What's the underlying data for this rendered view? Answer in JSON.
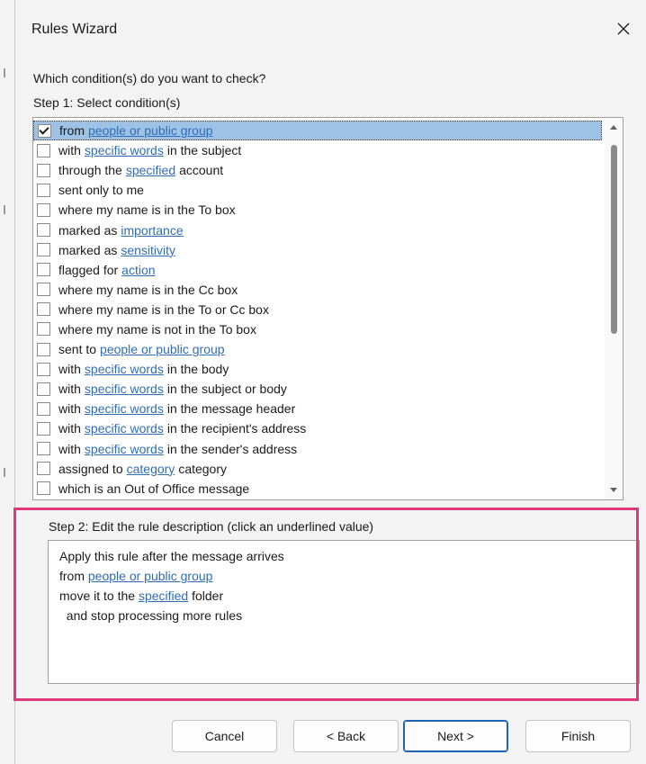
{
  "dialog": {
    "title": "Rules Wizard",
    "question": "Which condition(s) do you want to check?",
    "step1_label": "Step 1: Select condition(s)",
    "conditions": [
      {
        "pre": "from",
        "link": "people or public group",
        "post": "",
        "checked": true,
        "selected": true
      },
      {
        "pre": "with",
        "link": "specific words",
        "post": "in the subject",
        "checked": false
      },
      {
        "pre": "through the",
        "link": "specified",
        "post": "account",
        "checked": false
      },
      {
        "pre": "sent only to me",
        "link": "",
        "post": "",
        "checked": false
      },
      {
        "pre": "where my name is in the To box",
        "link": "",
        "post": "",
        "checked": false
      },
      {
        "pre": "marked as",
        "link": "importance",
        "post": "",
        "checked": false
      },
      {
        "pre": "marked as",
        "link": "sensitivity",
        "post": "",
        "checked": false
      },
      {
        "pre": "flagged for",
        "link": "action",
        "post": "",
        "checked": false
      },
      {
        "pre": "where my name is in the Cc box",
        "link": "",
        "post": "",
        "checked": false
      },
      {
        "pre": "where my name is in the To or Cc box",
        "link": "",
        "post": "",
        "checked": false
      },
      {
        "pre": "where my name is not in the To box",
        "link": "",
        "post": "",
        "checked": false
      },
      {
        "pre": "sent to",
        "link": "people or public group",
        "post": "",
        "checked": false
      },
      {
        "pre": "with",
        "link": "specific words",
        "post": "in the body",
        "checked": false
      },
      {
        "pre": "with",
        "link": "specific words",
        "post": "in the subject or body",
        "checked": false
      },
      {
        "pre": "with",
        "link": "specific words",
        "post": "in the message header",
        "checked": false
      },
      {
        "pre": "with",
        "link": "specific words",
        "post": "in the recipient's address",
        "checked": false
      },
      {
        "pre": "with",
        "link": "specific words",
        "post": "in the sender's address",
        "checked": false
      },
      {
        "pre": "assigned to",
        "link": "category",
        "post": "category",
        "checked": false
      },
      {
        "pre": "which is an Out of Office message",
        "link": "",
        "post": "",
        "checked": false
      }
    ],
    "step2_label": "Step 2: Edit the rule description (click an underlined value)",
    "description": {
      "line1": "Apply this rule after the message arrives",
      "line2_pre": "from ",
      "line2_link": "people or public group",
      "line3_pre": "move it to the ",
      "line3_link": "specified",
      "line3_post": " folder",
      "line4": "  and stop processing more rules"
    },
    "buttons": {
      "cancel": "Cancel",
      "back": "< Back",
      "next": "Next >",
      "finish": "Finish"
    }
  },
  "colors": {
    "highlight_border": "#e0387e",
    "link": "#2f6db5",
    "selection": "#9ec2e6"
  }
}
